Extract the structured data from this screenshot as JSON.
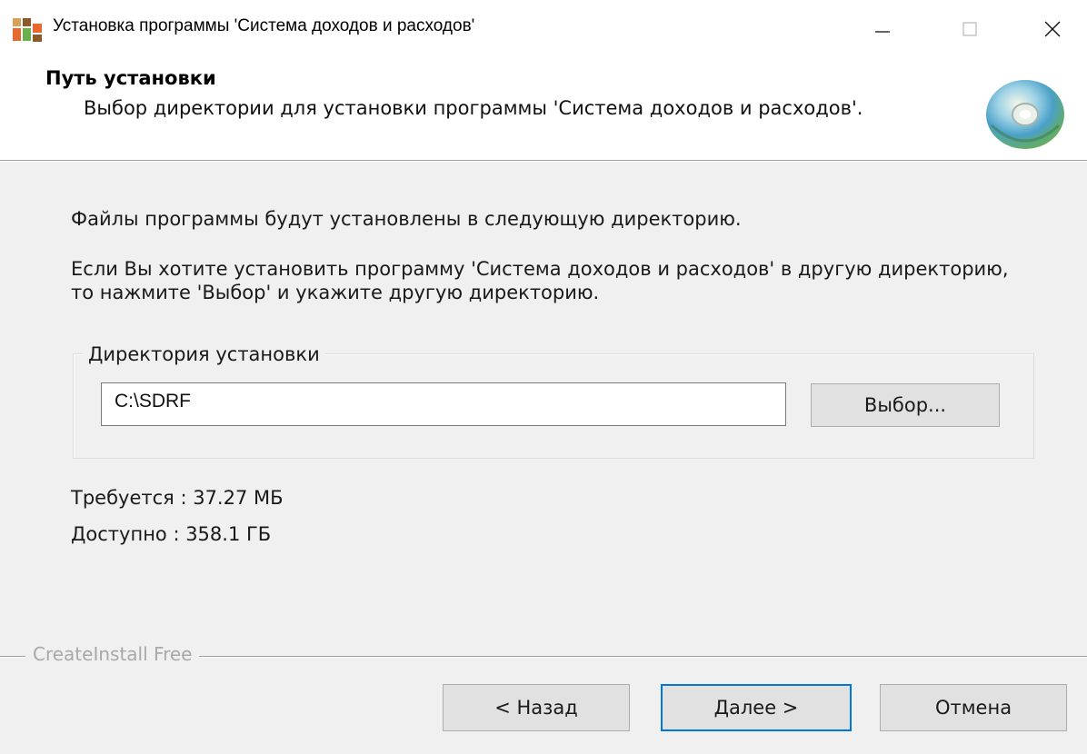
{
  "window": {
    "title": "Установка программы 'Система доходов и расходов'",
    "controls": [
      "minimize-icon",
      "maximize-icon",
      "close-icon"
    ]
  },
  "header": {
    "title": "Путь установки",
    "subtitle": "Выбор директории для установки программы 'Система доходов и расходов'.",
    "icon": "cd-disc-icon"
  },
  "body": {
    "line1": "Файлы программы будут установлены в следующую директорию.",
    "line2": "Если Вы хотите установить программу 'Система доходов и расходов' в другую директорию, то нажмите 'Выбор' и укажите другую директорию."
  },
  "install_dir": {
    "group_label": "Директория установки",
    "path_value": "C:\\SDRF",
    "browse_label": "Выбор..."
  },
  "space": {
    "required": "Требуется : 37.27 МБ",
    "available": "Доступно : 358.1 ГБ"
  },
  "footer": {
    "brand": "CreateInstall Free",
    "back_label": "< Назад",
    "next_label": "Далее >",
    "cancel_label": "Отмена"
  },
  "colors": {
    "accent": "#0078d7",
    "icon_orange": "#e8692e",
    "icon_green": "#6ab04c",
    "icon_brown": "#8b5a2b"
  }
}
